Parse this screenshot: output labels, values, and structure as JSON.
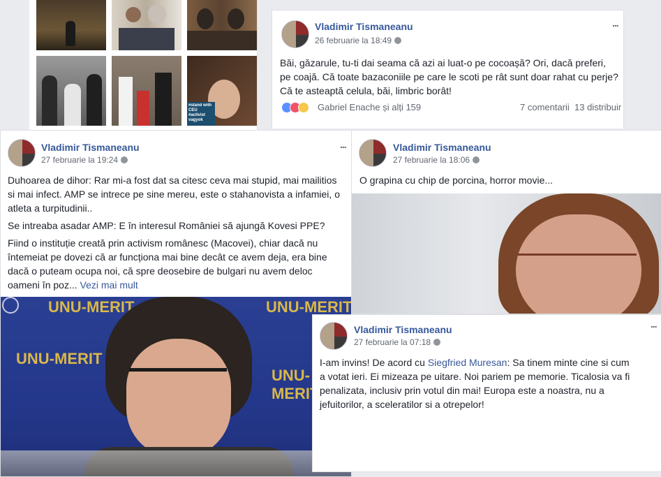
{
  "post1": {
    "author": "Vladimir Tismaneanu",
    "date": "26 februarie la 18:49",
    "text": "Băi, găzarule, tu-ti dai seama că azi ai luat-o pe cocoașă? Ori, dacă preferi, pe coajă. Că toate bazaconiile pe care le scoti pe rât sunt doar rahat cu perje? Că te asteaptă celula, băi, limbric borât!",
    "reactions": "Gabriel Enache și alți 159",
    "comments": "7 comentarii",
    "shares": "13 distribuir"
  },
  "post2": {
    "author": "Vladimir Tismaneanu",
    "date": "27 februarie la 19:24",
    "p1": "Duhoarea de dihor: Rar mi-a fost dat sa citesc ceva mai stupid, mai mailitios si mai infect. AMP se intrece pe sine mereu, este o stahanovista a infamiei, o atleta a turpitudinii..",
    "p2": "Se intreaba asadar AMP: E în interesul României să ajungă Kovesi PPE?",
    "p3": "Fiind o instituție creată prin activism românesc (Macovei), chiar dacă nu întemeiat pe dovezi că ar funcționa mai bine decât ce avem deja, era bine dacă o puteam ocupa noi, că spre deosebire de bulgari nu avem deloc oameni în poz...",
    "more": "Vezi mai mult"
  },
  "post3": {
    "author": "Vladimir Tismaneanu",
    "date": "27 februarie la 18:06",
    "text": "O grapina cu chip de porcina, horror movie..."
  },
  "post4": {
    "author": "Vladimir Tismaneanu",
    "date": "27 februarie la 07:18",
    "text_before": "I-am invins! De acord cu ",
    "mention": "Siegfried Muresan",
    "text_after": ": Sa tinem minte cine si cum a votat ieri. Ei mizeaza pe uitare. Noi pariem pe memorie. Ticalosia va fi penalizata, inclusiv prin votul din mai! Europa este a noastra, nu a jefuitorilor, a sceleratilor si a otrepelor!"
  },
  "banner": {
    "unu_merit_1": "UNU-MERIT",
    "unu_merit_2": "UNU-MERIT",
    "unu_merit_3": "UNU-MERIT",
    "unu_merit_4": "UNU-MERIT"
  },
  "gallery_tag": "#stand with CEU #activist vagyok",
  "more_icon": "..."
}
